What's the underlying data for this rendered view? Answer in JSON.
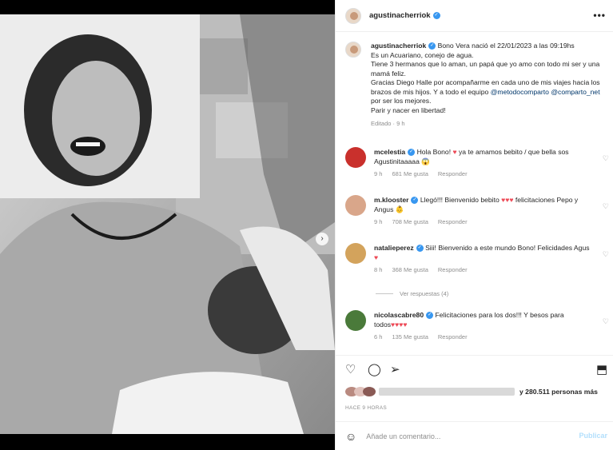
{
  "header": {
    "username": "agustinacherriok",
    "more_label": "•••"
  },
  "caption": {
    "username": "agustinacherriok",
    "line1": "Bono Vera nació el 22/01/2023 a las 09:19hs",
    "line2": "Es un Acuariano, conejo de agua.",
    "line3": "Tiene 3 hermanos que lo aman, un papá que yo amo con todo mi ser y una mamá feliz.",
    "line4": "Gracias Diego Halle por acompañarme en cada uno de mis viajes hacia los brazos de mis hijos. Y a todo el equipo",
    "mention1": "@metodocomparto",
    "mention2": "@comparto_net",
    "line4_end": "por ser los mejores.",
    "line5": "Parir y nacer en libertad!",
    "meta": "Editado · 9 h"
  },
  "comments": [
    {
      "username": "mcelestia",
      "text_a": "Hola Bono!",
      "text_b": "ya te amamos bebito / que bella sos Agustinitaaaaa 😱",
      "time": "9 h",
      "likes": "681 Me gusta",
      "reply": "Responder",
      "color": "#c9302c"
    },
    {
      "username": "m.klooster",
      "text_a": "Llegó!!! Bienvenido bebito",
      "text_b": "felicitaciones Pepo y Angus 👶",
      "time": "9 h",
      "likes": "708 Me gusta",
      "reply": "Responder",
      "color": "#d9a68a"
    },
    {
      "username": "natalieperez",
      "text_a": "Siii! Bienvenido a este mundo Bono!",
      "text_b": "Felicidades Agus",
      "time": "8 h",
      "likes": "368 Me gusta",
      "reply": "Responder",
      "color": "#d3a35c"
    },
    {
      "username": "nicolascabre80",
      "text_a": "Felicitaciones para los dos!!! Y besos para",
      "text_b": "todos",
      "time": "6 h",
      "likes": "135 Me gusta",
      "reply": "Responder",
      "color": "#4a7a3a"
    }
  ],
  "replies_label": "Ver respuestas (4)",
  "likes_text": "y 280.511 personas más",
  "time_ago": "HACE 9 HORAS",
  "add_comment": {
    "placeholder": "Añade un comentario...",
    "publish_label": "Publicar"
  },
  "colors": {
    "verified": "#3897f0",
    "heart": "#ed4956",
    "link": "#00376b"
  }
}
